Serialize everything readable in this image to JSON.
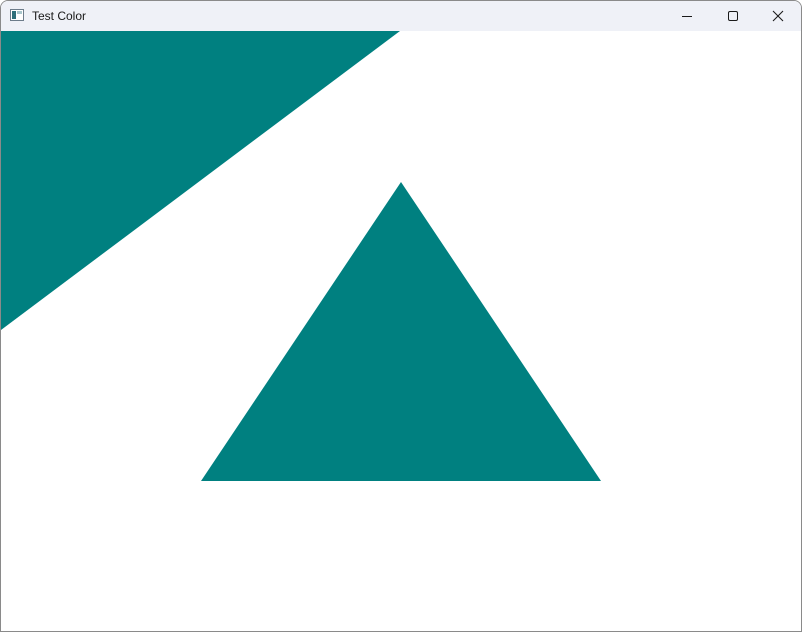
{
  "window": {
    "title": "Test Color",
    "app_icon": "window-app-icon",
    "controls": {
      "minimize_icon": "minimize-icon",
      "maximize_icon": "maximize-icon",
      "close_icon": "close-icon"
    }
  },
  "canvas": {
    "background_color": "#ffffff",
    "fill_color": "#008080",
    "shapes": [
      "large-triangle-top-left",
      "triangle-center"
    ]
  }
}
